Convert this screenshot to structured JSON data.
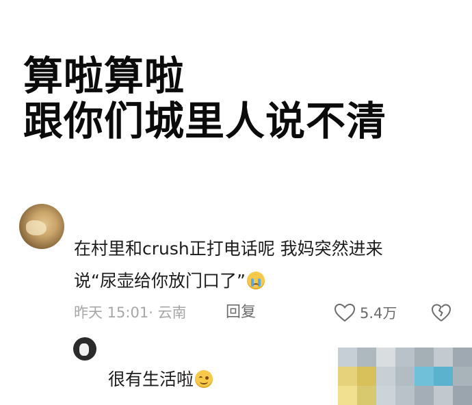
{
  "headline": {
    "line1": "算啦算啦",
    "line2": "跟你们城里人说不清"
  },
  "comment": {
    "text_line1": "在村里和crush正打电话呢 我妈突然进来",
    "text_line2": "说“尿壶给你放门口了”",
    "emoji": "loudly-crying-face",
    "time": "昨天 15:01",
    "location": "云南",
    "reply_label": "回复",
    "like_count": "5.4万"
  },
  "reply": {
    "text": "很有生活啦",
    "emoji": "smiling-face"
  },
  "colors": {
    "headline": "#0b0b0b",
    "body_text": "#1c1c1c",
    "meta_text": "#a6a6a6",
    "action_text": "#6b6b6b",
    "emoji_yellow": "#f6c94a"
  },
  "mosaic_colors": [
    "#c7cfd6",
    "#aeb8bf",
    "#d9dde0",
    "#b8c2c8",
    "#a5afb6",
    "#c3cbd1",
    "#9ea9b1",
    "#e6d27a",
    "#d8c05a",
    "#c8d0d6",
    "#b2bcc3",
    "#6fc0d8",
    "#5ab2cf",
    "#a8b3ba",
    "#f0e090",
    "#d9c96e",
    "#ccd3d9",
    "#b9c2c9",
    "#a3aeb6",
    "#c1c9cf",
    "#9aa5ad"
  ]
}
